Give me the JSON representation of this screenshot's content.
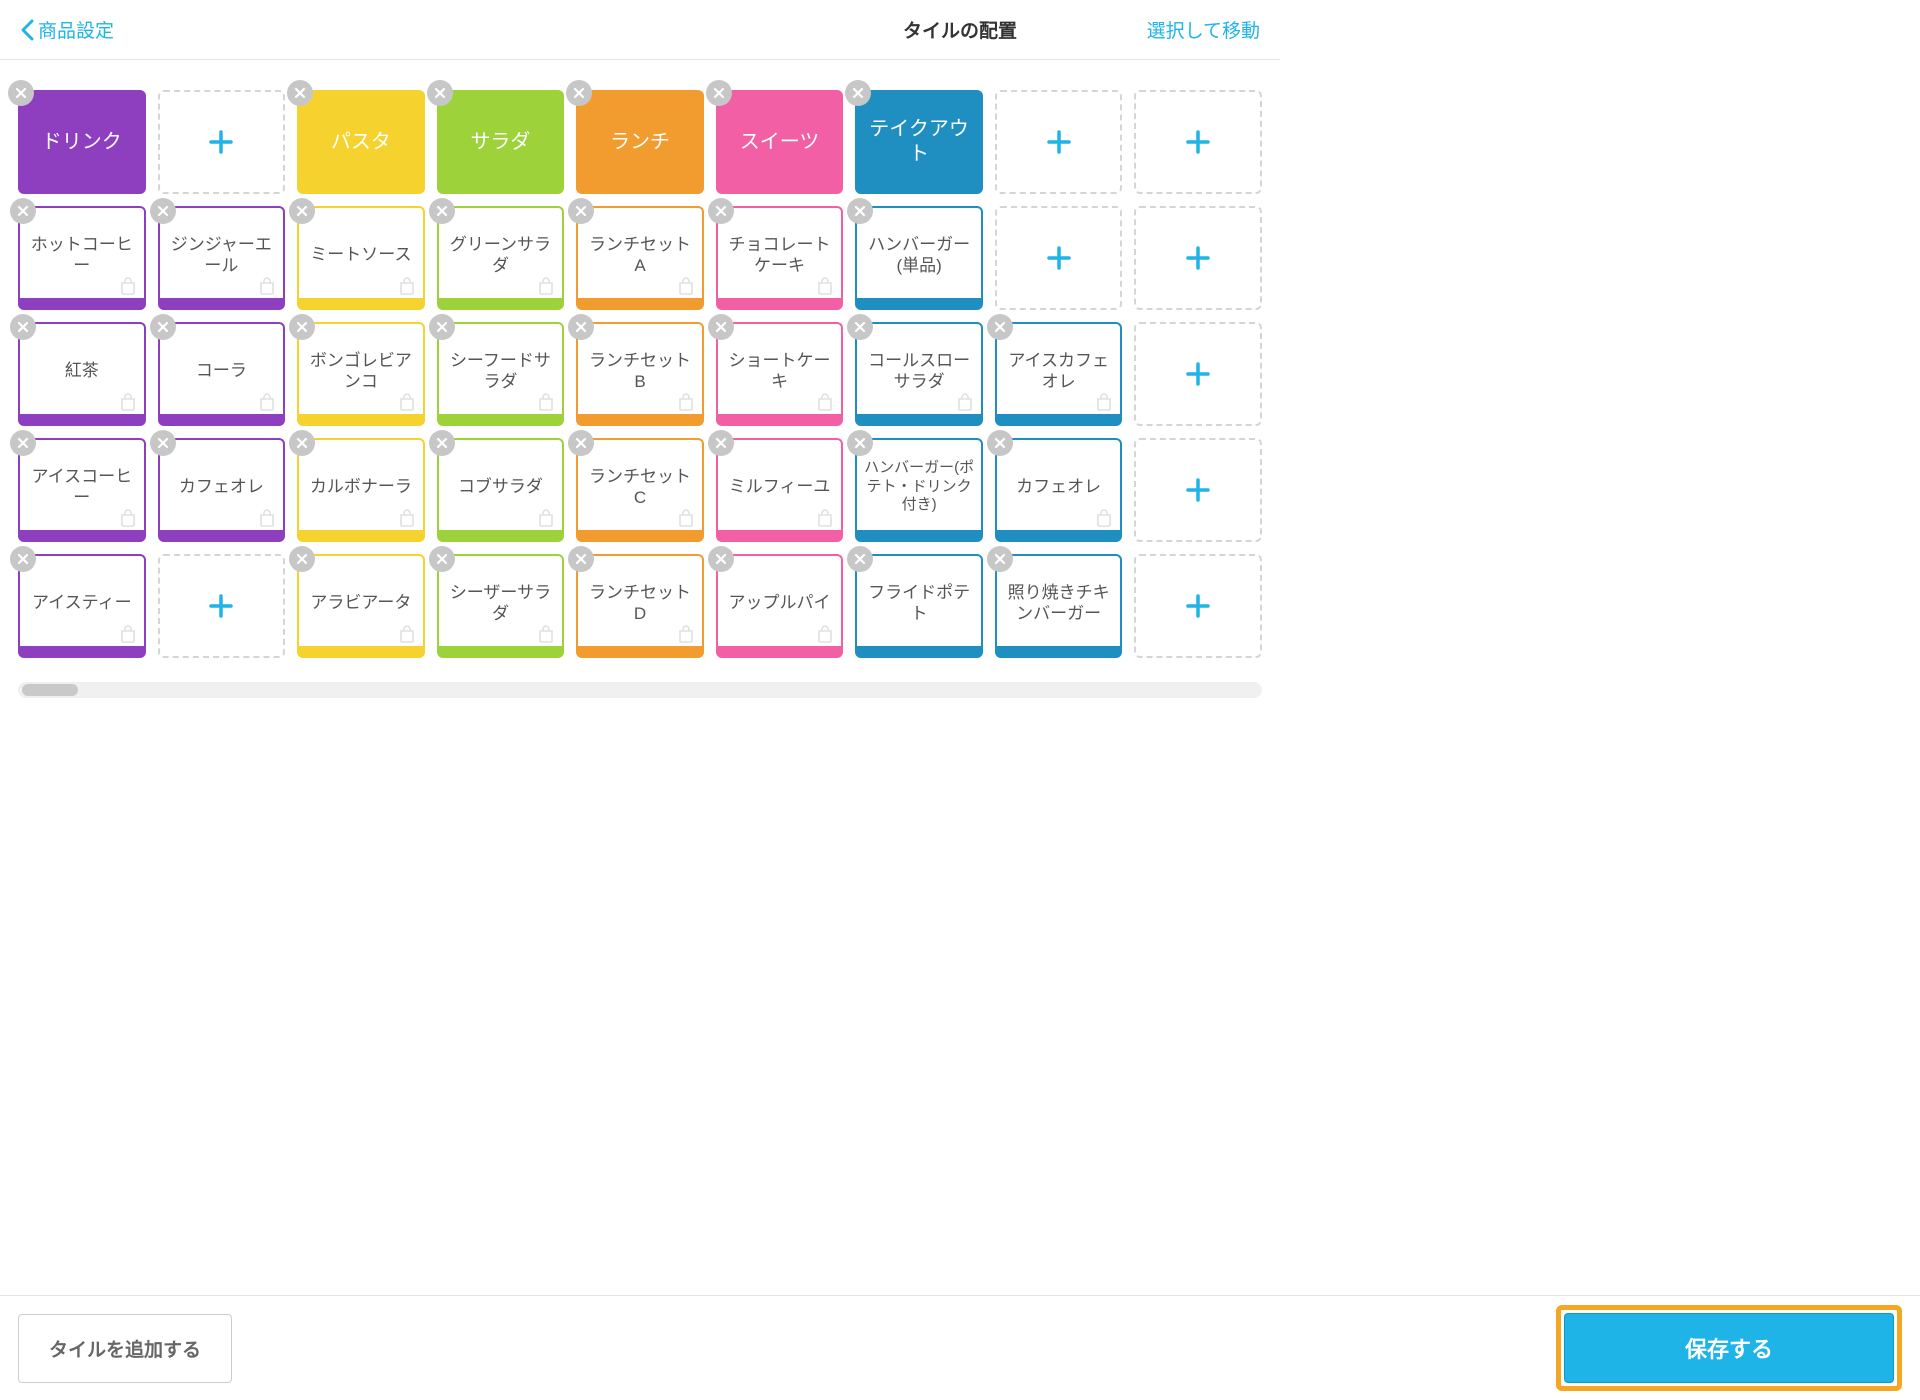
{
  "header": {
    "back_label": "商品設定",
    "title": "タイルの配置",
    "select_move": "選択して移動"
  },
  "footer": {
    "add_tile": "タイルを追加する",
    "save": "保存する"
  },
  "colors": {
    "purple": "#8e3fbf",
    "yellow": "#f5d22d",
    "green": "#9ed23b",
    "orange": "#f29b2e",
    "pink": "#f35fa5",
    "blue": "#1f8fc2",
    "accent": "#1fb4e8",
    "highlight": "#f5a623"
  },
  "grid": [
    [
      {
        "type": "solid",
        "color": "purple",
        "label": "ドリンク"
      },
      {
        "type": "empty"
      },
      {
        "type": "solid",
        "color": "yellow",
        "label": "パスタ"
      },
      {
        "type": "solid",
        "color": "green",
        "label": "サラダ"
      },
      {
        "type": "solid",
        "color": "orange",
        "label": "ランチ"
      },
      {
        "type": "solid",
        "color": "pink",
        "label": "スイーツ"
      },
      {
        "type": "solid",
        "color": "blue",
        "label": "テイクアウト"
      },
      {
        "type": "empty"
      },
      {
        "type": "empty"
      }
    ],
    [
      {
        "type": "outline",
        "color": "purple",
        "label": "ホットコーヒー",
        "bag": true
      },
      {
        "type": "outline",
        "color": "purple",
        "label": "ジンジャーエール",
        "bag": true
      },
      {
        "type": "outline",
        "color": "yellow",
        "label": "ミートソース",
        "bag": true
      },
      {
        "type": "outline",
        "color": "green",
        "label": "グリーンサラダ",
        "bag": true
      },
      {
        "type": "outline",
        "color": "orange",
        "label": "ランチセットA",
        "bag": true
      },
      {
        "type": "outline",
        "color": "pink",
        "label": "チョコレートケーキ",
        "bag": true
      },
      {
        "type": "outline",
        "color": "blue",
        "label": "ハンバーガー(単品)"
      },
      {
        "type": "empty"
      },
      {
        "type": "empty"
      }
    ],
    [
      {
        "type": "outline",
        "color": "purple",
        "label": "紅茶",
        "bag": true
      },
      {
        "type": "outline",
        "color": "purple",
        "label": "コーラ",
        "bag": true
      },
      {
        "type": "outline",
        "color": "yellow",
        "label": "ボンゴレビアンコ",
        "bag": true
      },
      {
        "type": "outline",
        "color": "green",
        "label": "シーフードサラダ",
        "bag": true
      },
      {
        "type": "outline",
        "color": "orange",
        "label": "ランチセットB",
        "bag": true
      },
      {
        "type": "outline",
        "color": "pink",
        "label": "ショートケーキ",
        "bag": true
      },
      {
        "type": "outline",
        "color": "blue",
        "label": "コールスローサラダ",
        "bag": true
      },
      {
        "type": "outline",
        "color": "blue",
        "label": "アイスカフェオレ",
        "bag": true
      },
      {
        "type": "empty"
      }
    ],
    [
      {
        "type": "outline",
        "color": "purple",
        "label": "アイスコーヒー",
        "bag": true
      },
      {
        "type": "outline",
        "color": "purple",
        "label": "カフェオレ",
        "bag": true
      },
      {
        "type": "outline",
        "color": "yellow",
        "label": "カルボナーラ",
        "bag": true
      },
      {
        "type": "outline",
        "color": "green",
        "label": "コブサラダ",
        "bag": true
      },
      {
        "type": "outline",
        "color": "orange",
        "label": "ランチセットC",
        "bag": true
      },
      {
        "type": "outline",
        "color": "pink",
        "label": "ミルフィーユ",
        "bag": true
      },
      {
        "type": "outline",
        "color": "blue",
        "label": "ハンバーガー(ポテト・ドリンク付き)",
        "small": true
      },
      {
        "type": "outline",
        "color": "blue",
        "label": "カフェオレ",
        "bag": true
      },
      {
        "type": "empty"
      }
    ],
    [
      {
        "type": "outline",
        "color": "purple",
        "label": "アイスティー",
        "bag": true
      },
      {
        "type": "empty"
      },
      {
        "type": "outline",
        "color": "yellow",
        "label": "アラビアータ",
        "bag": true
      },
      {
        "type": "outline",
        "color": "green",
        "label": "シーザーサラダ",
        "bag": true
      },
      {
        "type": "outline",
        "color": "orange",
        "label": "ランチセットD",
        "bag": true
      },
      {
        "type": "outline",
        "color": "pink",
        "label": "アップルパイ",
        "bag": true
      },
      {
        "type": "outline",
        "color": "blue",
        "label": "フライドポテト"
      },
      {
        "type": "outline",
        "color": "blue",
        "label": "照り焼きチキンバーガー"
      },
      {
        "type": "empty"
      }
    ]
  ]
}
